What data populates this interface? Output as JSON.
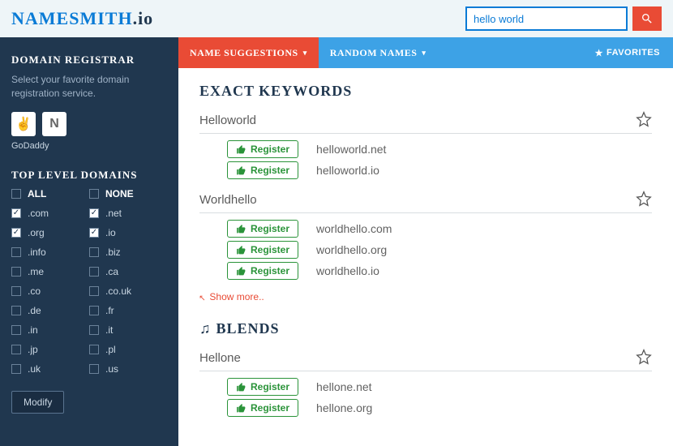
{
  "header": {
    "logo_a": "NAMESMITH",
    "logo_b": ".io",
    "search_value": "hello world"
  },
  "tabs": {
    "name_suggestions": "NAME SUGGESTIONS",
    "random_names": "RANDOM NAMES",
    "favorites": "FAVORITES"
  },
  "sidebar": {
    "registrar_title": "DOMAIN REGISTRAR",
    "registrar_desc": "Select your favorite domain registration service.",
    "registrar_label": "GoDaddy",
    "tld_title": "TOP LEVEL DOMAINS",
    "all": "ALL",
    "none": "NONE",
    "tlds": [
      {
        "label": ".com",
        "checked": true
      },
      {
        "label": ".net",
        "checked": true
      },
      {
        "label": ".org",
        "checked": true
      },
      {
        "label": ".io",
        "checked": true
      },
      {
        "label": ".info",
        "checked": false
      },
      {
        "label": ".biz",
        "checked": false
      },
      {
        "label": ".me",
        "checked": false
      },
      {
        "label": ".ca",
        "checked": false
      },
      {
        "label": ".co",
        "checked": false
      },
      {
        "label": ".co.uk",
        "checked": false
      },
      {
        "label": ".de",
        "checked": false
      },
      {
        "label": ".fr",
        "checked": false
      },
      {
        "label": ".in",
        "checked": false
      },
      {
        "label": ".it",
        "checked": false
      },
      {
        "label": ".jp",
        "checked": false
      },
      {
        "label": ".pl",
        "checked": false
      },
      {
        "label": ".uk",
        "checked": false
      },
      {
        "label": ".us",
        "checked": false
      }
    ],
    "modify": "Modify"
  },
  "results": {
    "register_label": "Register",
    "show_more": "Show more..",
    "sections": [
      {
        "title": "EXACT KEYWORDS",
        "icon": null,
        "names": [
          {
            "name": "Helloworld",
            "domains": [
              "helloworld.net",
              "helloworld.io"
            ]
          },
          {
            "name": "Worldhello",
            "domains": [
              "worldhello.com",
              "worldhello.org",
              "worldhello.io"
            ]
          }
        ],
        "show_more": true
      },
      {
        "title": "BLENDS",
        "icon": "music",
        "names": [
          {
            "name": "Hellone",
            "domains": [
              "hellone.net",
              "hellone.org"
            ]
          }
        ],
        "show_more": false
      }
    ]
  }
}
